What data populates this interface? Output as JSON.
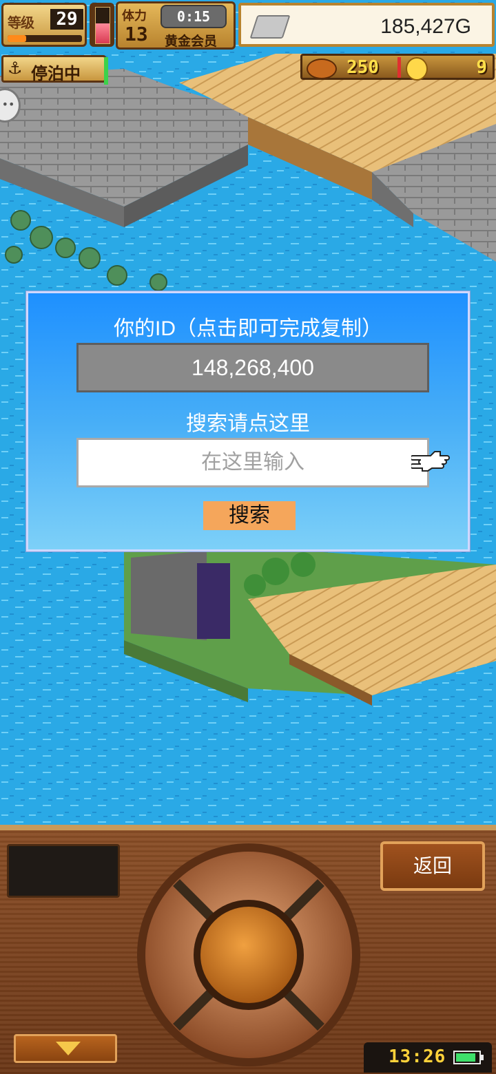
{
  "hud": {
    "level_label": "等级",
    "level": "29",
    "level_progress": 0.25,
    "stamina_fill": 0.55,
    "vip_tag": "体力",
    "vip_number": "13",
    "timer": "0:15",
    "member_label": "黄金会员",
    "gold": "185,427G",
    "dock_status": "停泊中",
    "food": "250",
    "coins": "9"
  },
  "dialog": {
    "title": "你的ID（点击即可完成复制）",
    "user_id": "148,268,400",
    "search_label": "搜索请点这里",
    "search_placeholder": "在这里输入",
    "search_button": "搜索"
  },
  "panel": {
    "back_button": "返回",
    "clock": "13:26",
    "battery_level": 0.9
  },
  "colors": {
    "dialog_top": "#1e90ff",
    "dialog_bottom": "#7dd0f8",
    "search_button": "#f5a65b",
    "panel_wood": "#7a4220"
  }
}
